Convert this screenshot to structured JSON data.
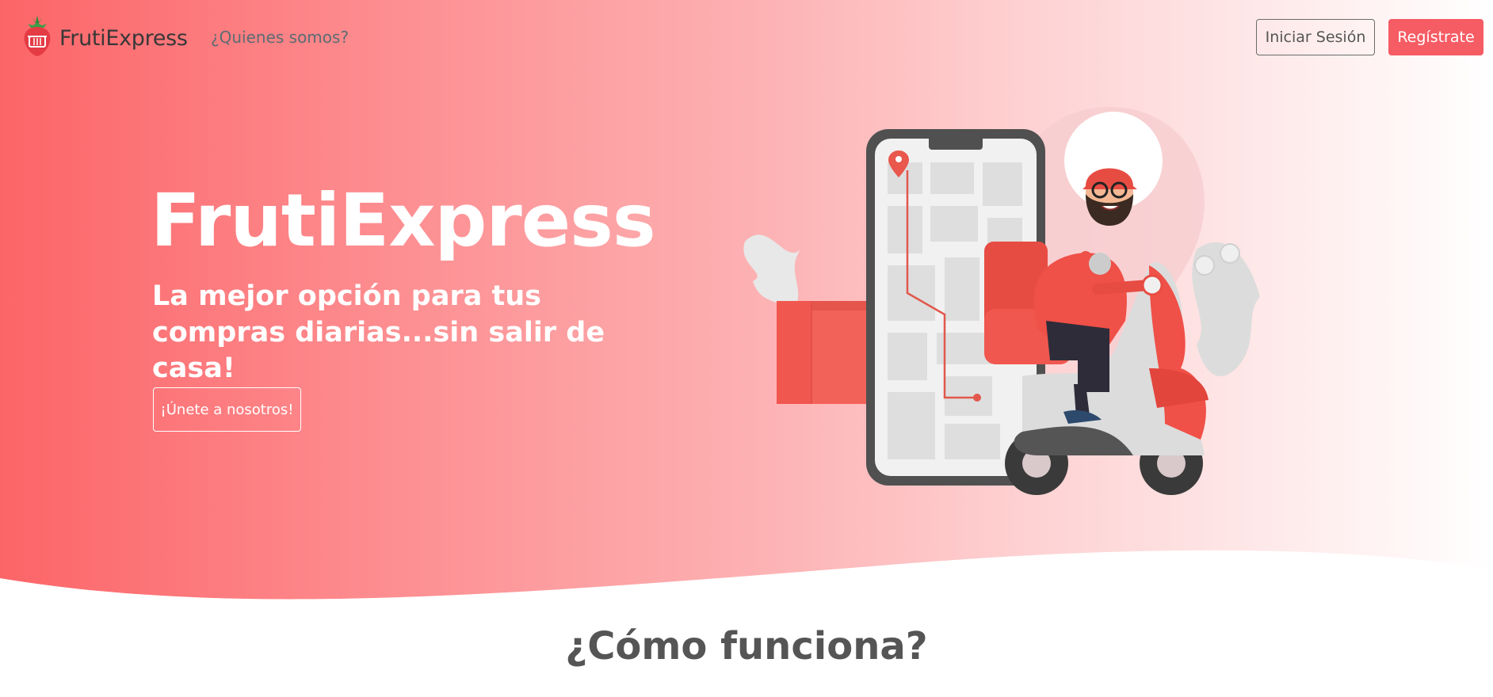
{
  "nav": {
    "brand": "FrutiExpress",
    "link_about": "¿Quienes somos?",
    "login_label": "Iniciar Sesión",
    "register_label": "Regístrate"
  },
  "hero": {
    "title": "FrutiExpress",
    "subtitle": "La mejor opción para tus compras diarias...sin salir de casa!",
    "cta_label": "¡Únete a nosotros!",
    "illustration": "delivery-scooter-phone-map-illustration"
  },
  "section": {
    "title": "¿Cómo funciona?"
  },
  "colors": {
    "accent": "#f65c64",
    "gradient_start": "#fc6568",
    "text_dark": "#555555"
  },
  "icons": {
    "logo": "strawberry-basket-icon"
  }
}
